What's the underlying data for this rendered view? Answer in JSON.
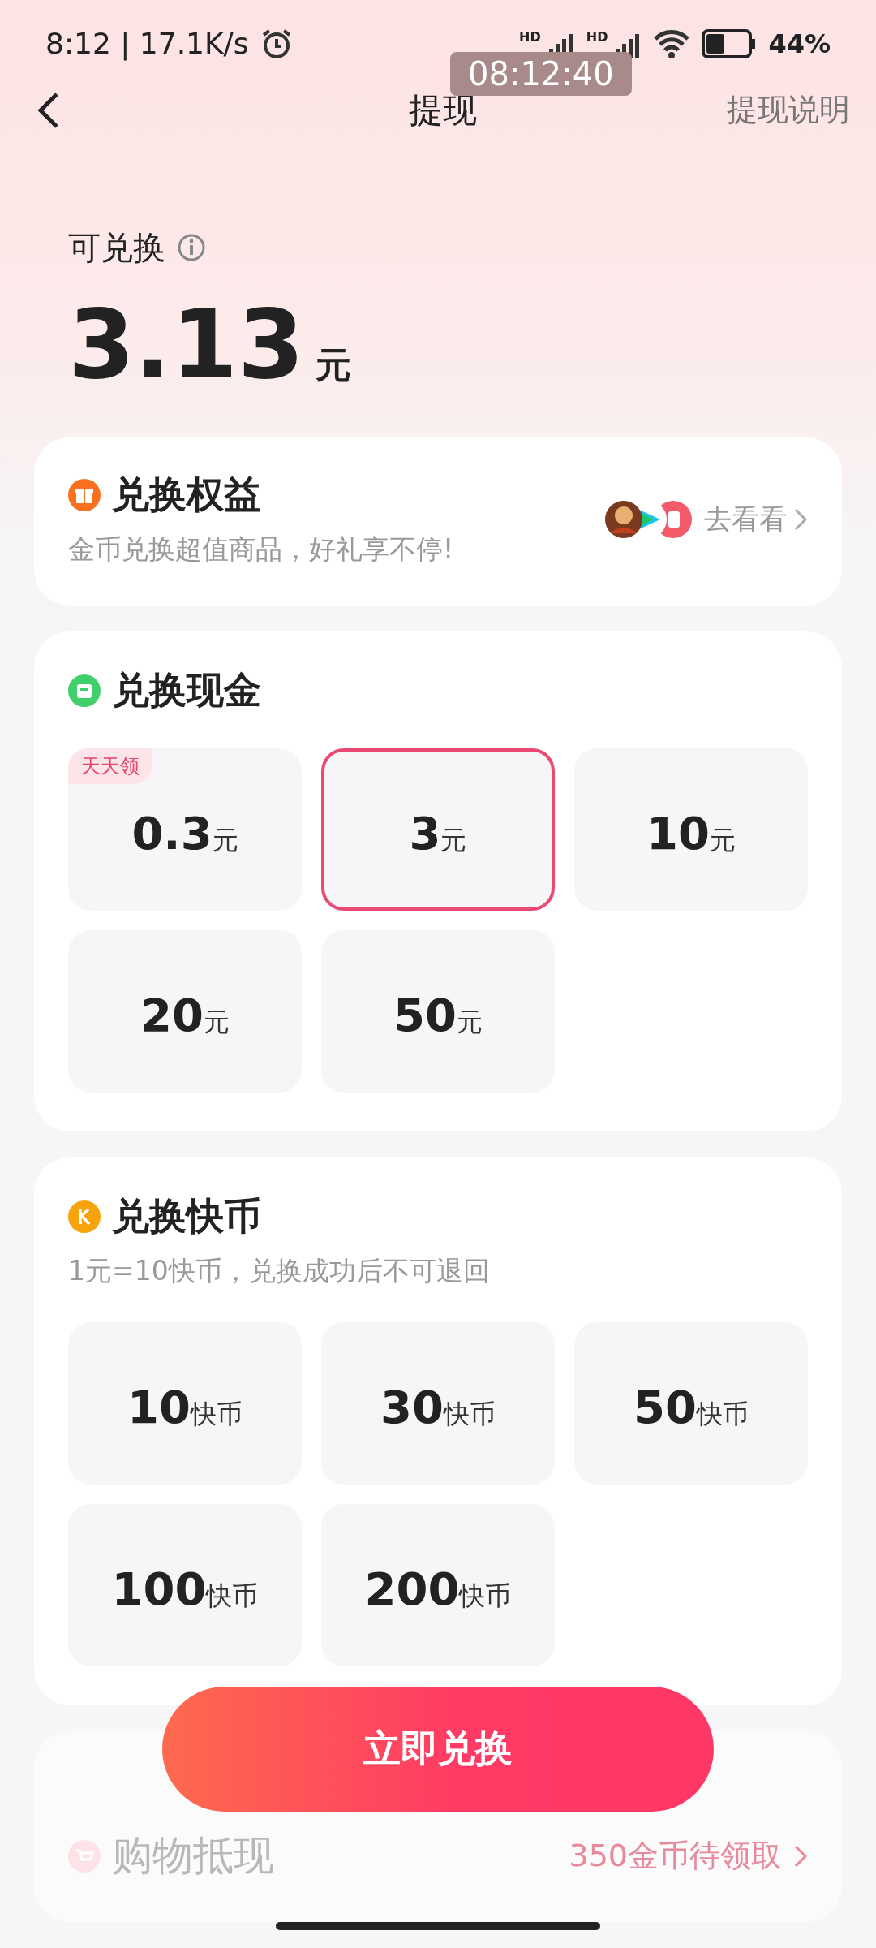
{
  "status_bar": {
    "time": "8:12 | 17.1K/s",
    "sim_labels": [
      "HD",
      "HD"
    ],
    "battery": "44%",
    "clock_overlay": "08:12:40"
  },
  "header": {
    "title": "提现",
    "action": "提现说明"
  },
  "balance": {
    "label": "可兑换",
    "amount": "3.13",
    "unit": "元"
  },
  "rights": {
    "title": "兑换权益",
    "subtitle": "金币兑换超值商品，好礼享不停!",
    "link": "去看看"
  },
  "cash": {
    "title": "兑换现金",
    "options": [
      {
        "value": "0.3",
        "unit": "元",
        "badge": "天天领",
        "selected": false
      },
      {
        "value": "3",
        "unit": "元",
        "selected": true
      },
      {
        "value": "10",
        "unit": "元",
        "selected": false
      },
      {
        "value": "20",
        "unit": "元",
        "selected": false
      },
      {
        "value": "50",
        "unit": "元",
        "selected": false
      }
    ]
  },
  "coins": {
    "title": "兑换快币",
    "note": "1元=10快币，兑换成功后不可退回",
    "options": [
      {
        "value": "10",
        "unit": "快币",
        "selected": false
      },
      {
        "value": "30",
        "unit": "快币",
        "selected": false
      },
      {
        "value": "50",
        "unit": "快币",
        "selected": false
      },
      {
        "value": "100",
        "unit": "快币",
        "selected": false
      },
      {
        "value": "200",
        "unit": "快币",
        "selected": false
      }
    ]
  },
  "submit": "立即兑换",
  "shopping": {
    "title": "购物抵现",
    "reward": "350金币待领取"
  }
}
